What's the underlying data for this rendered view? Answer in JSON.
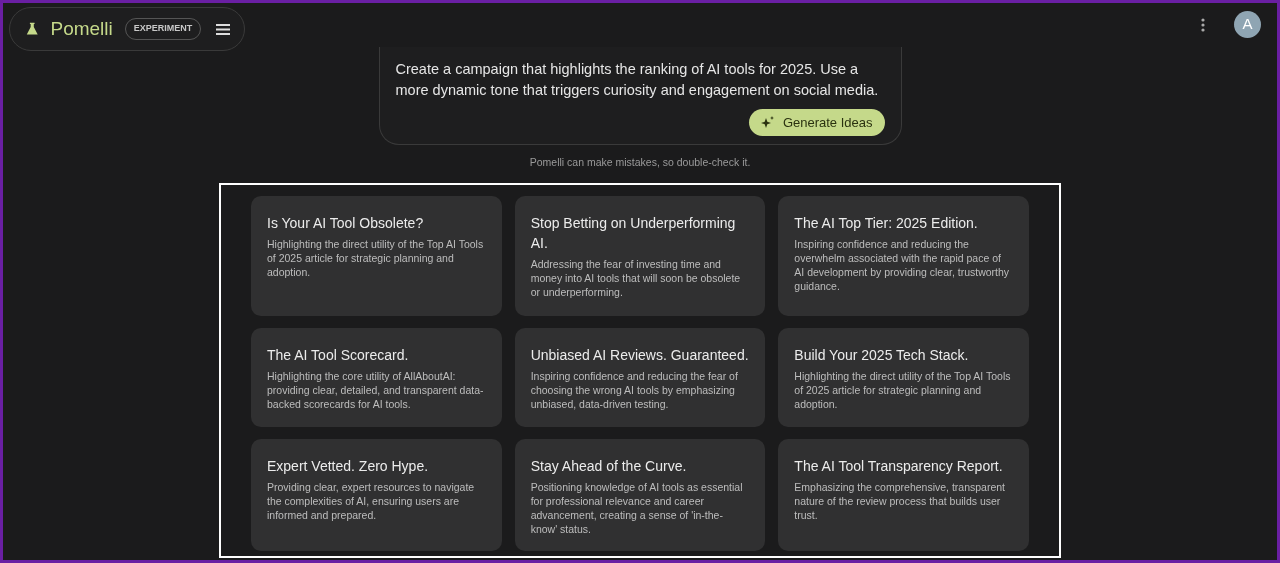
{
  "header": {
    "app_name": "Pomelli",
    "badge": "EXPERIMENT",
    "avatar": "A"
  },
  "prompt": {
    "value": "Create a campaign that highlights the ranking of AI tools for 2025. Use a more dynamic tone that triggers curiosity and engagement on social media.",
    "button": "Generate Ideas"
  },
  "disclaimer": "Pomelli can make mistakes, so double-check it.",
  "ideas": [
    {
      "title": "Is Your AI Tool Obsolete?",
      "description": "Highlighting the direct utility of the Top AI Tools of 2025 article for strategic planning and adoption."
    },
    {
      "title": "Stop Betting on Underperforming AI.",
      "description": "Addressing the fear of investing time and money into AI tools that will soon be obsolete or underperforming."
    },
    {
      "title": "The AI Top Tier: 2025 Edition.",
      "description": "Inspiring confidence and reducing the overwhelm associated with the rapid pace of AI development by providing clear, trustworthy guidance."
    },
    {
      "title": "The AI Tool Scorecard.",
      "description": "Highlighting the core utility of AllAboutAI: providing clear, detailed, and transparent data-backed scorecards for AI tools."
    },
    {
      "title": "Unbiased AI Reviews. Guaranteed.",
      "description": "Inspiring confidence and reducing the fear of choosing the wrong AI tools by emphasizing unbiased, data-driven testing."
    },
    {
      "title": "Build Your 2025 Tech Stack.",
      "description": "Highlighting the direct utility of the Top AI Tools of 2025 article for strategic planning and adoption."
    },
    {
      "title": "Expert Vetted. Zero Hype.",
      "description": "Providing clear, expert resources to navigate the complexities of AI, ensuring users are informed and prepared."
    },
    {
      "title": "Stay Ahead of the Curve.",
      "description": "Positioning knowledge of AI tools as essential for professional relevance and career advancement, creating a sense of 'in-the-know' status."
    },
    {
      "title": "The AI Tool Transparency Report.",
      "description": "Emphasizing the comprehensive, transparent nature of the review process that builds user trust."
    }
  ]
}
